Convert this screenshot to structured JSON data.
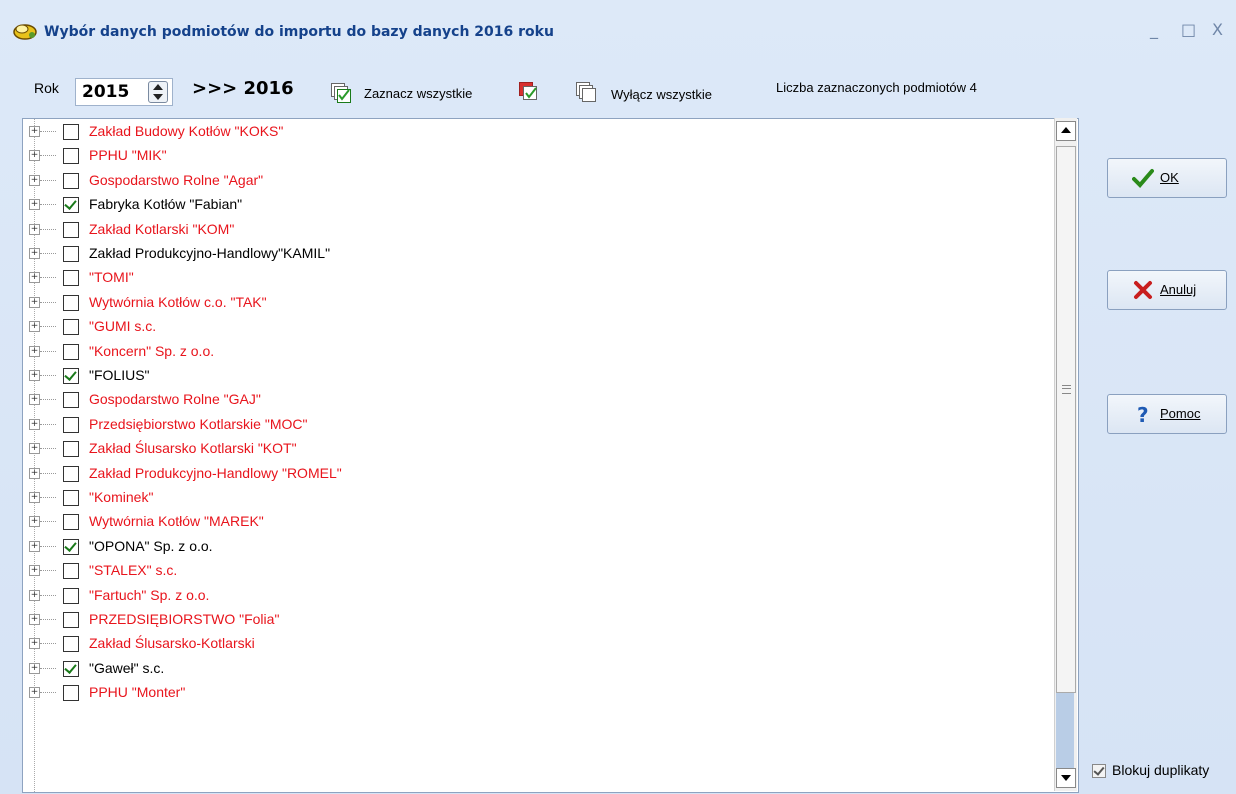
{
  "window": {
    "title": "Wybór danych podmiotów do importu do bazy danych 2016 roku",
    "controls": {
      "minimize": "_",
      "maximize": "□",
      "close": "X"
    }
  },
  "toolbar": {
    "year_label": "Rok",
    "year_value": "2015",
    "target_year": ">>> 2016",
    "select_all_label": "Zaznacz wszystkie",
    "deselect_all_label": "Wyłącz  wszystkie",
    "selected_count_text": "Liczba zaznaczonych podmiotów 4"
  },
  "list": {
    "items": [
      {
        "label": "Zakład Budowy Kotłów \"KOKS\"",
        "checked": false,
        "color": "#e8141c"
      },
      {
        "label": "PPHU \"MIK\"",
        "checked": false,
        "color": "#e8141c"
      },
      {
        "label": "Gospodarstwo  Rolne \"Agar\"",
        "checked": false,
        "color": "#e8141c"
      },
      {
        "label": "Fabryka Kotłów \"Fabian\"",
        "checked": true,
        "color": "#000000"
      },
      {
        "label": "Zakład Kotlarski \"KOM\"",
        "checked": false,
        "color": "#e8141c"
      },
      {
        "label": "Zakład Produkcyjno-Handlowy\"KAMIL\"",
        "checked": false,
        "color": "#000000"
      },
      {
        "label": "\"TOMI\"",
        "checked": false,
        "color": "#e8141c"
      },
      {
        "label": "Wytwórnia Kotłów c.o. \"TAK\"",
        "checked": false,
        "color": "#e8141c"
      },
      {
        "label": "\"GUMI s.c.",
        "checked": false,
        "color": "#e8141c"
      },
      {
        "label": "\"Koncern\" Sp. z o.o.",
        "checked": false,
        "color": "#e8141c"
      },
      {
        "label": "\"FOLIUS\"",
        "checked": true,
        "color": "#000000"
      },
      {
        "label": "Gospodarstwo  Rolne \"GAJ\"",
        "checked": false,
        "color": "#e8141c"
      },
      {
        "label": "Przedsiębiorstwo Kotlarskie \"MOC\"",
        "checked": false,
        "color": "#e8141c"
      },
      {
        "label": "Zakład Ślusarsko Kotlarski \"KOT\"",
        "checked": false,
        "color": "#e8141c"
      },
      {
        "label": "Zakład Produkcyjno-Handlowy \"ROMEL\"",
        "checked": false,
        "color": "#e8141c"
      },
      {
        "label": "\"Kominek\"",
        "checked": false,
        "color": "#e8141c"
      },
      {
        "label": "Wytwórnia Kotłów \"MAREK\"",
        "checked": false,
        "color": "#e8141c"
      },
      {
        "label": "\"OPONA\" Sp. z o.o.",
        "checked": true,
        "color": "#000000"
      },
      {
        "label": "\"STALEX\" s.c.",
        "checked": false,
        "color": "#e8141c"
      },
      {
        "label": "\"Fartuch\" Sp. z o.o.",
        "checked": false,
        "color": "#e8141c"
      },
      {
        "label": "PRZEDSIĘBIORSTWO \"Folia\"",
        "checked": false,
        "color": "#e8141c"
      },
      {
        "label": "Zakład Ślusarsko-Kotlarski",
        "checked": false,
        "color": "#e8141c"
      },
      {
        "label": "\"Gaweł\" s.c.",
        "checked": true,
        "color": "#000000"
      },
      {
        "label": "PPHU \"Monter\"",
        "checked": false,
        "color": "#e8141c"
      }
    ]
  },
  "buttons": {
    "ok_label": "OK",
    "cancel_label": "Anuluj",
    "help_label": "Pomoc"
  },
  "options": {
    "block_duplicates_label": "Blokuj duplikaty",
    "block_duplicates_checked": true
  }
}
